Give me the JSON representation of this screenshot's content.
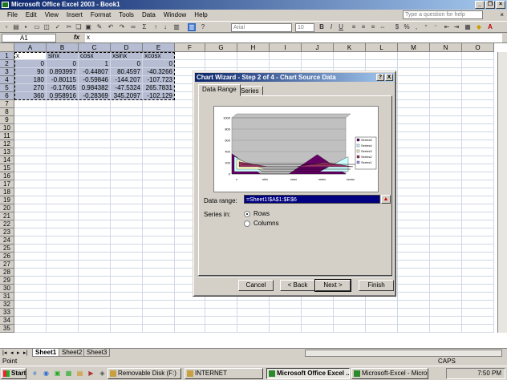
{
  "window": {
    "title": "Microsoft Office Excel 2003 - Book1"
  },
  "menu": {
    "items": [
      "File",
      "Edit",
      "View",
      "Insert",
      "Format",
      "Tools",
      "Data",
      "Window",
      "Help"
    ],
    "help_placeholder": "Type a question for help"
  },
  "toolbar": {
    "font_name": "Arial",
    "font_size": "10"
  },
  "formula_bar": {
    "name_box": "A1",
    "fx": "fx",
    "value": "x"
  },
  "columns": [
    "A",
    "B",
    "C",
    "D",
    "E",
    "F",
    "G",
    "H",
    "I",
    "J",
    "K",
    "L",
    "M",
    "N",
    "O"
  ],
  "rows": [
    "1",
    "2",
    "3",
    "4",
    "5",
    "6",
    "7",
    "8",
    "9",
    "10",
    "11",
    "12",
    "13",
    "14",
    "15",
    "16",
    "17",
    "18",
    "19",
    "20",
    "21",
    "22",
    "23",
    "24",
    "25",
    "26",
    "27",
    "28",
    "29",
    "30",
    "31",
    "32",
    "33",
    "34",
    "35"
  ],
  "cells": [
    [
      "x",
      "sinx",
      "cosx",
      "xsinx",
      "xcosx"
    ],
    [
      "0",
      "0",
      "1",
      "0",
      "0"
    ],
    [
      "90",
      "0.893997",
      "-0.44807",
      "80.4597",
      "-40.3266"
    ],
    [
      "180",
      "-0.80115",
      "-0.59846",
      "-144.207",
      "-107.723"
    ],
    [
      "270",
      "-0.17605",
      "0.984382",
      "-47.5324",
      "265.7831"
    ],
    [
      "360",
      "0.958916",
      "-0.28369",
      "345.2097",
      "-102.129"
    ]
  ],
  "sheet_tabs": [
    "Sheet1",
    "Sheet2",
    "Sheet3"
  ],
  "status": {
    "left": "Point",
    "caps": "CAPS"
  },
  "taskbar": {
    "start": "Start",
    "buttons": [
      "Removable Disk (F:)",
      "INTERNET",
      "Microsoft Office Excel ...",
      "Microsoft-Excel - Microso..."
    ],
    "clock": "7:50 PM"
  },
  "dialog": {
    "title": "Chart Wizard - Step 2 of 4 - Chart Source Data",
    "help_btn": "?",
    "close_btn": "X",
    "tabs": [
      "Data Range",
      "Series"
    ],
    "data_range_label": "Data range:",
    "data_range_value": "=Sheet1!$A$1:$E$6",
    "series_in_label": "Series in:",
    "rows_option": "Rows",
    "columns_option": "Columns",
    "buttons": {
      "cancel": "Cancel",
      "back": "< Back",
      "next": "Next >",
      "finish": "Finish"
    }
  },
  "chart_data": {
    "type": "area",
    "categories": [
      "x",
      "sinx",
      "cosx",
      "xsinx",
      "xcosx"
    ],
    "ylim": [
      0,
      1000
    ],
    "yticks": [
      "1000",
      "800",
      "600",
      "400",
      "200",
      "0"
    ],
    "series": [
      {
        "name": "Series1",
        "values": [
          0,
          0,
          1,
          0,
          0
        ],
        "color": "#9999ff"
      },
      {
        "name": "Series2",
        "values": [
          90,
          0.893997,
          -0.44807,
          80.4597,
          -40.3266
        ],
        "color": "#993366"
      },
      {
        "name": "Series3",
        "values": [
          180,
          -0.80115,
          -0.59846,
          -144.207,
          -107.723
        ],
        "color": "#ffffcc"
      },
      {
        "name": "Series4",
        "values": [
          270,
          -0.17605,
          0.984382,
          -47.5324,
          265.7831
        ],
        "color": "#ccffff"
      },
      {
        "name": "Series5",
        "values": [
          360,
          0.958916,
          -0.28369,
          345.2097,
          -102.129
        ],
        "color": "#660066"
      }
    ],
    "legend_labels": [
      "Series5",
      "Series4",
      "Series3",
      "Series2",
      "Series1"
    ],
    "legend_position": "right"
  }
}
